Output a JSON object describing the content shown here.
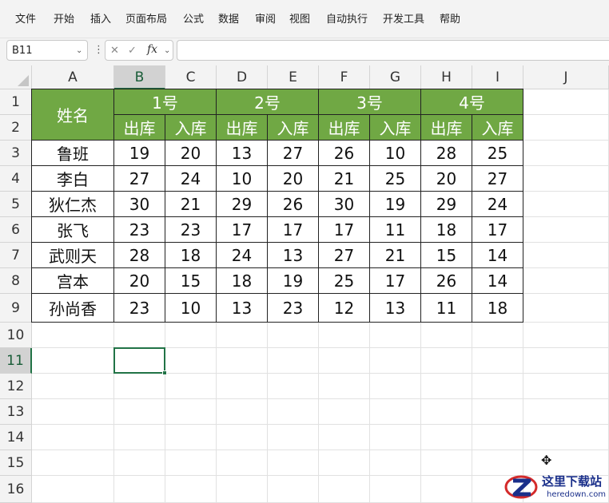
{
  "menu": [
    "文件",
    "开始",
    "插入",
    "页面布局",
    "公式",
    "数据",
    "审阅",
    "视图",
    "自动执行",
    "开发工具",
    "帮助"
  ],
  "formula_bar": {
    "name_box": "B11",
    "fx_label": "fx",
    "formula": ""
  },
  "icons": {
    "chevron": "⌄",
    "more": "⋮",
    "cancel": "✕",
    "enter": "✓",
    "cursor": "✥"
  },
  "columns": [
    "A",
    "B",
    "C",
    "D",
    "E",
    "F",
    "G",
    "H",
    "I",
    "J"
  ],
  "rows": [
    "1",
    "2",
    "3",
    "4",
    "5",
    "6",
    "7",
    "8",
    "9",
    "10",
    "11",
    "12",
    "13",
    "14",
    "15",
    "16"
  ],
  "table": {
    "name_header": "姓名",
    "groups": [
      "1号",
      "2号",
      "3号",
      "4号"
    ],
    "sub_headers": [
      "出库",
      "入库",
      "出库",
      "入库",
      "出库",
      "入库",
      "出库",
      "入库"
    ],
    "records": [
      {
        "name": "鲁班",
        "values": [
          "19",
          "20",
          "13",
          "27",
          "26",
          "10",
          "28",
          "25"
        ]
      },
      {
        "name": "李白",
        "values": [
          "27",
          "24",
          "10",
          "20",
          "21",
          "25",
          "20",
          "27"
        ]
      },
      {
        "name": "狄仁杰",
        "values": [
          "30",
          "21",
          "29",
          "26",
          "30",
          "19",
          "29",
          "24"
        ]
      },
      {
        "name": "张飞",
        "values": [
          "23",
          "23",
          "17",
          "17",
          "17",
          "11",
          "18",
          "17"
        ]
      },
      {
        "name": "武则天",
        "values": [
          "28",
          "18",
          "24",
          "13",
          "27",
          "21",
          "15",
          "14"
        ]
      },
      {
        "name": "宫本",
        "values": [
          "20",
          "15",
          "18",
          "19",
          "25",
          "17",
          "26",
          "14"
        ]
      },
      {
        "name": "孙尚香",
        "values": [
          "23",
          "10",
          "13",
          "23",
          "12",
          "13",
          "11",
          "18"
        ]
      }
    ]
  },
  "selection": {
    "cell": "B11",
    "column": "B",
    "row": "11"
  },
  "colors": {
    "header_green": "#70a844",
    "selection": "#217346"
  },
  "watermark": {
    "cn": "这里下载站",
    "en": "heredown.com"
  }
}
